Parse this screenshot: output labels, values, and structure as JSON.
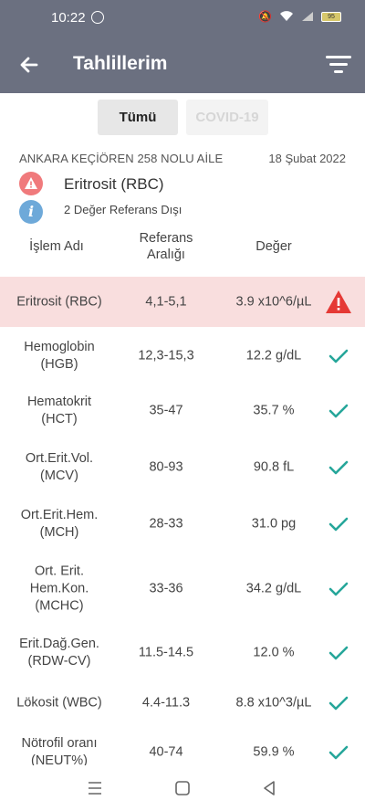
{
  "status_bar": {
    "time": "10:22",
    "battery": "95"
  },
  "app_bar": {
    "title": "Tahlillerim"
  },
  "tabs": [
    {
      "label": "Tümü",
      "active": true
    },
    {
      "label": "COVID-19",
      "active": false
    }
  ],
  "report": {
    "clinic": "ANKARA KEÇİÖREN 258 NOLU AİLE",
    "date": "18 Şubat 2022",
    "alert_title": "Eritrosit (RBC)",
    "info_text": "2 Değer Referans Dışı"
  },
  "table": {
    "headers": {
      "name": "İşlem Adı",
      "ref_line1": "Referans",
      "ref_line2": "Aralığı",
      "value": "Değer"
    },
    "rows": [
      {
        "name": "Eritrosit (RBC)",
        "ref": "4,1-5,1",
        "value": "3.9 x10^6/µL",
        "status": "warning"
      },
      {
        "name": "Hemoglobin\n(HGB)",
        "ref": "12,3-15,3",
        "value": "12.2 g/dL",
        "status": "ok"
      },
      {
        "name": "Hematokrit\n(HCT)",
        "ref": "35-47",
        "value": "35.7 %",
        "status": "ok"
      },
      {
        "name": "Ort.Erit.Vol.\n(MCV)",
        "ref": "80-93",
        "value": "90.8 fL",
        "status": "ok"
      },
      {
        "name": "Ort.Erit.Hem.\n(MCH)",
        "ref": "28-33",
        "value": "31.0 pg",
        "status": "ok"
      },
      {
        "name": "Ort. Erit.\nHem.Kon.\n(MCHC)",
        "ref": "33-36",
        "value": "34.2 g/dL",
        "status": "ok"
      },
      {
        "name": "Erit.Dağ.Gen.\n(RDW-CV)",
        "ref": "11.5-14.5",
        "value": "12.0 %",
        "status": "ok"
      },
      {
        "name": "Lökosit (WBC)",
        "ref": "4.4-11.3",
        "value": "8.8 x10^3/µL",
        "status": "ok"
      },
      {
        "name": "Nötrofil oranı\n(NEUT%)",
        "ref": "40-74",
        "value": "59.9 %",
        "status": "ok"
      }
    ]
  },
  "colors": {
    "header_bg": "#6b7080",
    "alert_row_bg": "#f9dede",
    "warning": "#e53935",
    "ok": "#26a69a"
  }
}
